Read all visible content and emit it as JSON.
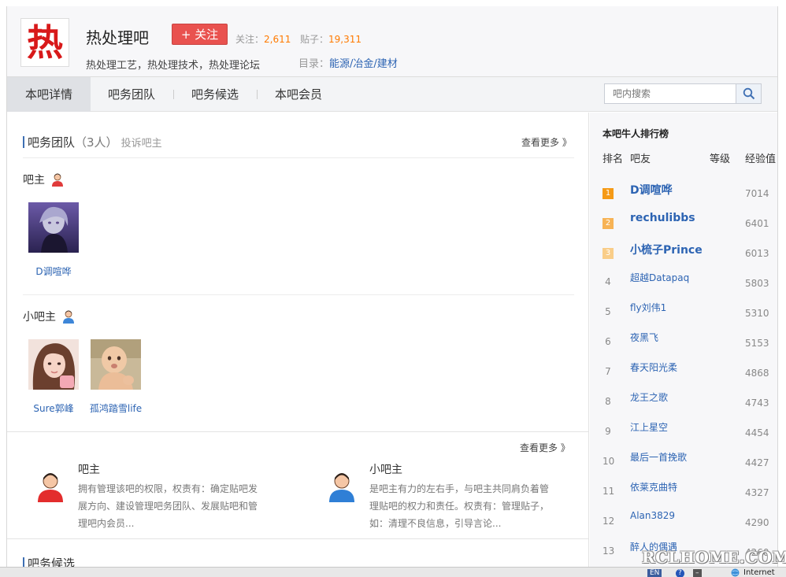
{
  "header": {
    "logo_char": "热",
    "title": "热处理吧",
    "follow_label": "+ 关注",
    "follow_stat_label": "关注：",
    "follow_count": "2,611",
    "post_stat_label": "贴子：",
    "post_count": "19,311",
    "subtitle": "热处理工艺，热处理技术，热处理论坛",
    "catalog_label": "目录：",
    "catalog_value": "能源/冶金/建材"
  },
  "nav": {
    "tabs": [
      "本吧详情",
      "吧务团队",
      "吧务候选",
      "本吧会员"
    ],
    "search_placeholder": "吧内搜索"
  },
  "team": {
    "heading": "吧务团队",
    "count": "（3人）",
    "complain": "投诉吧主",
    "more": "查看更多 》",
    "owner_label": "吧主",
    "owners": [
      {
        "name": "D调喧哗"
      }
    ],
    "assistant_label": "小吧主",
    "assistants": [
      {
        "name": "Sure郭峰"
      },
      {
        "name": "孤鸿踏雪life"
      }
    ]
  },
  "roles": {
    "more": "查看更多 》",
    "items": [
      {
        "title": "吧主",
        "desc": "拥有管理该吧的权限，权责有：确定贴吧发展方向、建设管理吧务团队、发展贴吧和管理吧内会员..."
      },
      {
        "title": "小吧主",
        "desc": "是吧主有力的左右手，与吧主共同肩负着管理贴吧的权力和责任。权责有：管理贴子，如：清理不良信息，引导言论..."
      }
    ]
  },
  "candidates": {
    "heading": "吧务候选"
  },
  "leaderboard": {
    "title": "本吧牛人排行榜",
    "col_rank": "排名",
    "col_user": "吧友",
    "col_level": "等级",
    "col_exp": "经验值",
    "rows": [
      {
        "rank": "1",
        "name": "D调喧哗",
        "exp": "7014"
      },
      {
        "rank": "2",
        "name": "rechulibbs",
        "exp": "6401"
      },
      {
        "rank": "3",
        "name": "小梳子Prince",
        "exp": "6013"
      },
      {
        "rank": "4",
        "name": "超越Datapaq",
        "exp": "5803"
      },
      {
        "rank": "5",
        "name": "fly刘伟1",
        "exp": "5310"
      },
      {
        "rank": "6",
        "name": "夜黑飞",
        "exp": "5153"
      },
      {
        "rank": "7",
        "name": "春天阳光柔",
        "exp": "4868"
      },
      {
        "rank": "8",
        "name": "龙王之歌",
        "exp": "4743"
      },
      {
        "rank": "9",
        "name": "江上星空",
        "exp": "4454"
      },
      {
        "rank": "10",
        "name": "最后一首挽歌",
        "exp": "4427"
      },
      {
        "rank": "11",
        "name": "依莱克曲特",
        "exp": "4327"
      },
      {
        "rank": "12",
        "name": "Alan3829",
        "exp": "4290"
      },
      {
        "rank": "13",
        "name": "醉人的偶遇",
        "exp": "4260"
      }
    ]
  },
  "statusbar": {
    "lang": "EN",
    "zone": "Internet"
  },
  "watermark": "RCLHOME.COM",
  "colors": {
    "accent": "#2d64b3",
    "follow": "#e9524f",
    "count": "#ff7a00",
    "rank1": "#f59a16",
    "rank2": "#f7b355",
    "rank3": "#f9cd89"
  }
}
